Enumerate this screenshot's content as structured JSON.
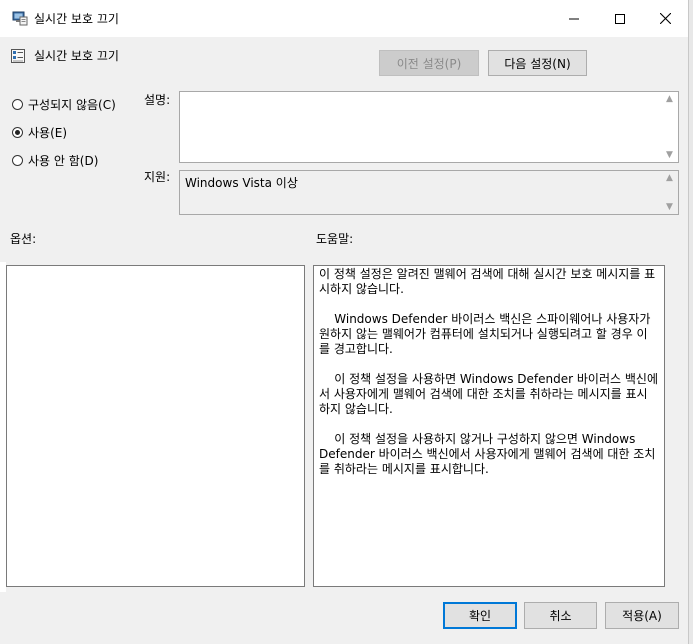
{
  "window": {
    "title": "실시간 보호 끄기",
    "header": "실시간 보호 끄기"
  },
  "nav": {
    "prev_label": "이전 설정(P)",
    "next_label": "다음 설정(N)"
  },
  "options": {
    "not_configured": "구성되지 않음(C)",
    "enabled": "사용(E)",
    "disabled": "사용 안 함(D)",
    "selected": "enabled"
  },
  "labels": {
    "comment": "설명:",
    "supported": "지원:",
    "options": "옵션:",
    "help": "도움말:"
  },
  "comment_value": "",
  "supported_value": "Windows Vista 이상",
  "help_paragraphs": [
    "이 정책 설정은 알려진 맬웨어 검색에 대해 실시간 보호 메시지를 표시하지 않습니다.",
    "    Windows Defender 바이러스 백신은 스파이웨어나 사용자가 원하지 않는 맬웨어가 컴퓨터에 설치되거나 실행되려고 할 경우 이를 경고합니다.",
    "    이 정책 설정을 사용하면 Windows Defender 바이러스 백신에서 사용자에게 맬웨어 검색에 대한 조치를 취하라는 메시지를 표시하지 않습니다.",
    "    이 정책 설정을 사용하지 않거나 구성하지 않으면 Windows Defender 바이러스 백신에서 사용자에게 맬웨어 검색에 대한 조치를 취하라는 메시지를 표시합니다."
  ],
  "buttons": {
    "ok": "확인",
    "cancel": "취소",
    "apply": "적용(A)"
  },
  "colors": {
    "accent": "#0078d7",
    "window_bg": "#f0f0f0"
  }
}
